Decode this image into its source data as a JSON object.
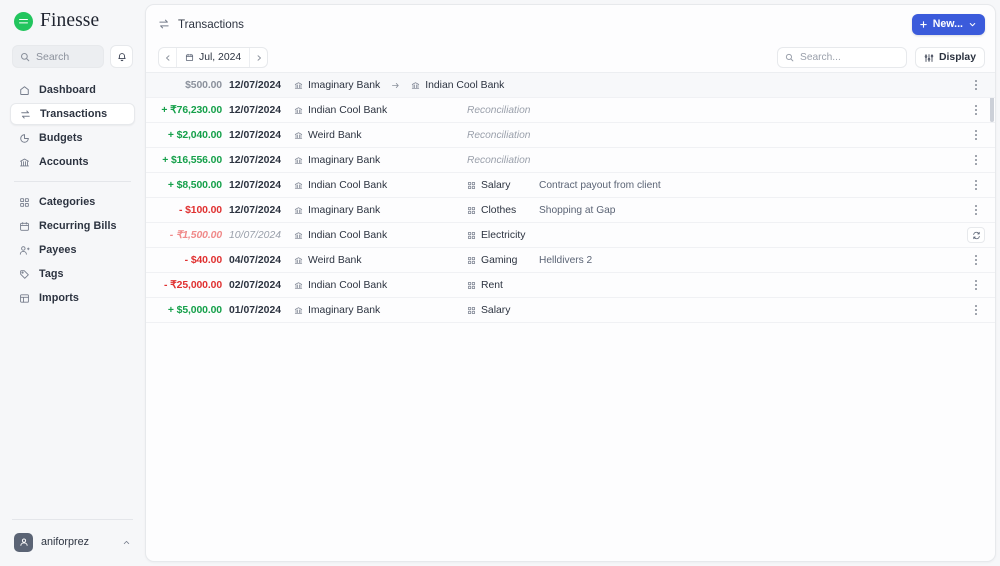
{
  "brand": {
    "name": "Finesse",
    "logo_color": "#22c55e",
    "icon": "finesse-logo-icon"
  },
  "sidebar": {
    "search": {
      "placeholder": "Search",
      "icon": "search-icon"
    },
    "notifications_icon": "bell-icon",
    "items": [
      {
        "label": "Dashboard",
        "icon": "home-icon",
        "active": false
      },
      {
        "label": "Transactions",
        "icon": "transfer-arrows-icon",
        "active": true
      },
      {
        "label": "Budgets",
        "icon": "pie-chart-icon",
        "active": false
      },
      {
        "label": "Accounts",
        "icon": "bank-icon",
        "active": false
      }
    ],
    "items_secondary": [
      {
        "label": "Categories",
        "icon": "grid-icon",
        "active": false
      },
      {
        "label": "Recurring Bills",
        "icon": "calendar-clock-icon",
        "active": false
      },
      {
        "label": "Payees",
        "icon": "user-plus-icon",
        "active": false
      },
      {
        "label": "Tags",
        "icon": "tag-icon",
        "active": false
      },
      {
        "label": "Imports",
        "icon": "table-plus-icon",
        "active": false
      }
    ],
    "user": {
      "name": "aniforprez",
      "avatar_icon": "user-icon",
      "chevron_icon": "chevron-up-icon"
    }
  },
  "header": {
    "page_icon": "transfer-arrows-icon",
    "title": "Transactions",
    "new_button": {
      "label": "New...",
      "plus_icon": "plus-icon",
      "chevron_icon": "chevron-down-icon",
      "color": "#3b5bdb"
    }
  },
  "toolbar": {
    "prev_icon": "chevron-left-icon",
    "next_icon": "chevron-right-icon",
    "calendar_icon": "calendar-icon",
    "period": "Jul, 2024",
    "search": {
      "placeholder": "Search...",
      "icon": "search-icon"
    },
    "display": {
      "label": "Display",
      "icon": "sliders-icon"
    }
  },
  "colors": {
    "positive": "#15a04a",
    "negative": "#e03131",
    "neutral": "#8b919c",
    "pending_negative": "#f08a8a",
    "accent": "#3b5bdb"
  },
  "transactions": [
    {
      "amount": "$500.00",
      "amount_kind": "neutral",
      "date": "12/07/2024",
      "date_muted": false,
      "account": "Imaginary Bank",
      "account_icon": "bank-icon",
      "is_transfer": true,
      "transfer_arrow_icon": "arrow-right-icon",
      "target_account": "Indian Cool Bank",
      "target_account_icon": "bank-icon",
      "category": "",
      "category_icon": "",
      "reconciliation": "",
      "note": "",
      "action_icon": "more-vertical-icon",
      "highlighted": true
    },
    {
      "amount": "+ ₹76,230.00",
      "amount_kind": "pos",
      "date": "12/07/2024",
      "date_muted": false,
      "account": "Indian Cool Bank",
      "account_icon": "bank-icon",
      "is_transfer": false,
      "target_account": "",
      "category": "",
      "category_icon": "",
      "reconciliation": "Reconciliation",
      "note": "",
      "action_icon": "more-vertical-icon",
      "highlighted": false
    },
    {
      "amount": "+ $2,040.00",
      "amount_kind": "pos",
      "date": "12/07/2024",
      "date_muted": false,
      "account": "Weird Bank",
      "account_icon": "bank-icon",
      "is_transfer": false,
      "target_account": "",
      "category": "",
      "category_icon": "",
      "reconciliation": "Reconciliation",
      "note": "",
      "action_icon": "more-vertical-icon",
      "highlighted": false
    },
    {
      "amount": "+ $16,556.00",
      "amount_kind": "pos",
      "date": "12/07/2024",
      "date_muted": false,
      "account": "Imaginary Bank",
      "account_icon": "bank-icon",
      "is_transfer": false,
      "target_account": "",
      "category": "",
      "category_icon": "",
      "reconciliation": "Reconciliation",
      "note": "",
      "action_icon": "more-vertical-icon",
      "highlighted": false
    },
    {
      "amount": "+ $8,500.00",
      "amount_kind": "pos",
      "date": "12/07/2024",
      "date_muted": false,
      "account": "Indian Cool Bank",
      "account_icon": "bank-icon",
      "is_transfer": false,
      "target_account": "",
      "category": "Salary",
      "category_icon": "grid-icon",
      "reconciliation": "",
      "note": "Contract payout from client",
      "action_icon": "more-vertical-icon",
      "highlighted": false
    },
    {
      "amount": "- $100.00",
      "amount_kind": "neg",
      "date": "12/07/2024",
      "date_muted": false,
      "account": "Imaginary Bank",
      "account_icon": "bank-icon",
      "is_transfer": false,
      "target_account": "",
      "category": "Clothes",
      "category_icon": "grid-icon",
      "reconciliation": "",
      "note": "Shopping at Gap",
      "action_icon": "more-vertical-icon",
      "highlighted": false
    },
    {
      "amount": "- ₹1,500.00",
      "amount_kind": "muted-neg",
      "date": "10/07/2024",
      "date_muted": true,
      "account": "Indian Cool Bank",
      "account_icon": "bank-icon",
      "is_transfer": false,
      "target_account": "",
      "category": "Electricity",
      "category_icon": "grid-icon",
      "reconciliation": "",
      "note": "",
      "action_icon": "recurring-icon",
      "highlighted": false
    },
    {
      "amount": "- $40.00",
      "amount_kind": "neg",
      "date": "04/07/2024",
      "date_muted": false,
      "account": "Weird Bank",
      "account_icon": "bank-icon",
      "is_transfer": false,
      "target_account": "",
      "category": "Gaming",
      "category_icon": "grid-icon",
      "reconciliation": "",
      "note": "Helldivers 2",
      "action_icon": "more-vertical-icon",
      "highlighted": false
    },
    {
      "amount": "- ₹25,000.00",
      "amount_kind": "neg",
      "date": "02/07/2024",
      "date_muted": false,
      "account": "Indian Cool Bank",
      "account_icon": "bank-icon",
      "is_transfer": false,
      "target_account": "",
      "category": "Rent",
      "category_icon": "grid-icon",
      "reconciliation": "",
      "note": "",
      "action_icon": "more-vertical-icon",
      "highlighted": false
    },
    {
      "amount": "+ $5,000.00",
      "amount_kind": "pos",
      "date": "01/07/2024",
      "date_muted": false,
      "account": "Imaginary Bank",
      "account_icon": "bank-icon",
      "is_transfer": false,
      "target_account": "",
      "category": "Salary",
      "category_icon": "grid-icon",
      "reconciliation": "",
      "note": "",
      "action_icon": "more-vertical-icon",
      "highlighted": false
    }
  ]
}
